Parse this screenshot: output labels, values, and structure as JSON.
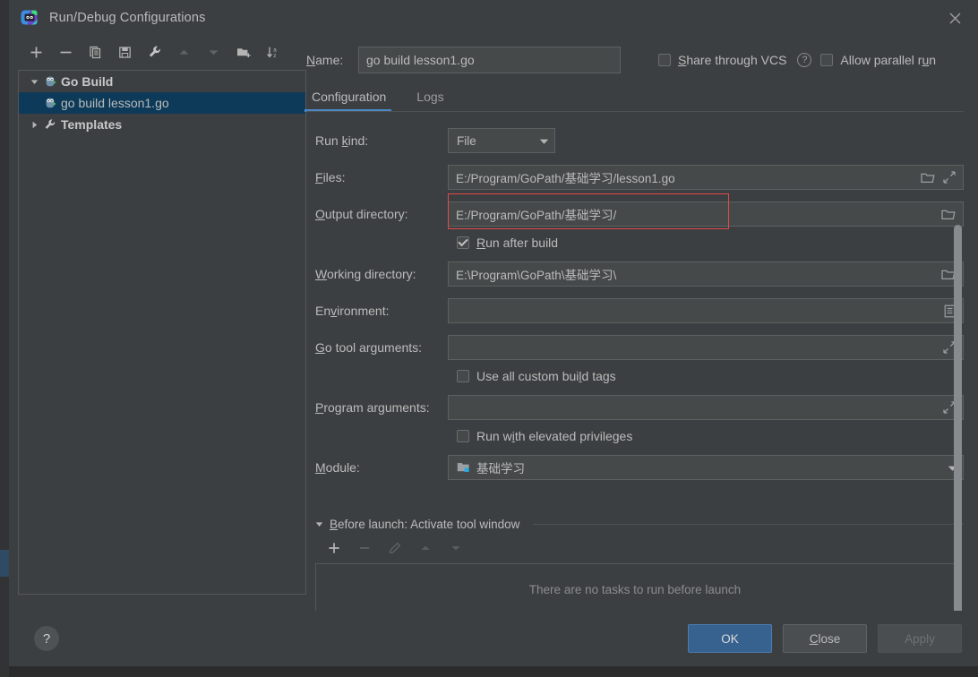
{
  "window": {
    "title": "Run/Debug Configurations",
    "app_icon": "goland-icon",
    "close_label": "×"
  },
  "tree_toolbar": {
    "buttons": [
      {
        "name": "add-configuration-button",
        "icon": "plus-icon",
        "enabled": true
      },
      {
        "name": "remove-configuration-button",
        "icon": "minus-icon",
        "enabled": true
      },
      {
        "name": "copy-configuration-button",
        "icon": "copy-icon",
        "enabled": true
      },
      {
        "name": "save-configuration-button",
        "icon": "save-icon",
        "enabled": true
      },
      {
        "name": "edit-templates-button",
        "icon": "wrench-icon",
        "enabled": true
      },
      {
        "name": "move-up-button",
        "icon": "arrow-up-icon",
        "enabled": false
      },
      {
        "name": "move-down-button",
        "icon": "arrow-down-icon",
        "enabled": false
      },
      {
        "name": "new-folder-button",
        "icon": "folder-add-icon",
        "enabled": true
      },
      {
        "name": "sort-alphabetically-button",
        "icon": "sort-az-icon",
        "enabled": true
      }
    ]
  },
  "tree": {
    "nodes": [
      {
        "label": "Go Build",
        "icon": "go-gopher-icon",
        "twisty": "expanded",
        "level": 0,
        "selected": false
      },
      {
        "label": "go build lesson1.go",
        "icon": "go-gopher-icon",
        "twisty": "none",
        "level": 1,
        "selected": true
      },
      {
        "label": "Templates",
        "icon": "wrench-icon",
        "twisty": "collapsed",
        "level": 0,
        "selected": false
      }
    ]
  },
  "name_row": {
    "label": "Name:",
    "label_mnemonic": "N",
    "value": "go build lesson1.go",
    "share_through_vcs": {
      "label": "Share through VCS",
      "mnemonic": "S",
      "checked": false
    },
    "help_icon": "question-mark-icon",
    "allow_parallel_run": {
      "label": "Allow parallel run",
      "mnemonic": "u",
      "checked": false
    }
  },
  "tabs": [
    {
      "label": "Configuration",
      "active": true
    },
    {
      "label": "Logs",
      "active": false
    }
  ],
  "form": {
    "run_kind": {
      "label": "Run kind:",
      "mnemonic": "k",
      "value": "File",
      "control": "combobox"
    },
    "files": {
      "label": "Files:",
      "mnemonic": "F",
      "value": "E:/Program/GoPath/基础学习/lesson1.go",
      "icons": [
        "folder-icon",
        "expand-icon"
      ]
    },
    "output_directory": {
      "label": "Output directory:",
      "mnemonic": "O",
      "value": "E:/Program/GoPath/基础学习/",
      "icons": [
        "folder-icon"
      ],
      "highlighted": true,
      "highlight_color": "#e04a4a"
    },
    "run_after_build": {
      "label": "Run after build",
      "mnemonic": "R",
      "checked": true
    },
    "working_directory": {
      "label": "Working directory:",
      "mnemonic": "W",
      "value": "E:\\Program\\GoPath\\基础学习\\",
      "icons": [
        "folder-icon"
      ]
    },
    "environment": {
      "label": "Environment:",
      "mnemonic": "v",
      "value": "",
      "icons": [
        "list-icon"
      ]
    },
    "go_tool_arguments": {
      "label": "Go tool arguments:",
      "mnemonic": "G",
      "value": "",
      "icons": [
        "expand-icon"
      ]
    },
    "use_all_custom_build_tags": {
      "label": "Use all custom build tags",
      "mnemonic": "l",
      "checked": false
    },
    "program_arguments": {
      "label": "Program arguments:",
      "mnemonic": "P",
      "value": "",
      "icons": [
        "expand-icon"
      ]
    },
    "run_with_elevated_privileges": {
      "label": "Run with elevated privileges",
      "mnemonic": "i",
      "checked": false
    },
    "module": {
      "label": "Module:",
      "mnemonic": "M",
      "value": "基础学习",
      "icon": "module-folder-icon",
      "control": "combobox"
    }
  },
  "before_launch": {
    "title": "Before launch: Activate tool window",
    "mnemonic": "B",
    "twisty": "expanded",
    "buttons": [
      {
        "name": "add-task-button",
        "icon": "plus-icon",
        "enabled": true
      },
      {
        "name": "remove-task-button",
        "icon": "minus-icon",
        "enabled": false
      },
      {
        "name": "edit-task-button",
        "icon": "pencil-icon",
        "enabled": false
      },
      {
        "name": "task-move-up-button",
        "icon": "arrow-up-icon",
        "enabled": false
      },
      {
        "name": "task-move-down-button",
        "icon": "arrow-down-icon",
        "enabled": false
      }
    ],
    "empty_text": "There are no tasks to run before launch"
  },
  "footer": {
    "help_label": "?",
    "ok": {
      "label": "OK",
      "primary": true,
      "enabled": true
    },
    "close": {
      "label": "Close",
      "mnemonic": "C",
      "enabled": true
    },
    "apply": {
      "label": "Apply",
      "mnemonic": "A",
      "enabled": false
    }
  },
  "colors": {
    "dialog_background": "#3c3f41",
    "field_background": "#45494a",
    "text_primary": "#bbbbbb",
    "accent_blue": "#4a88c7",
    "selection_blue": "#0d3a58",
    "primary_button": "#37618e",
    "error_outline": "#e04a4a"
  }
}
